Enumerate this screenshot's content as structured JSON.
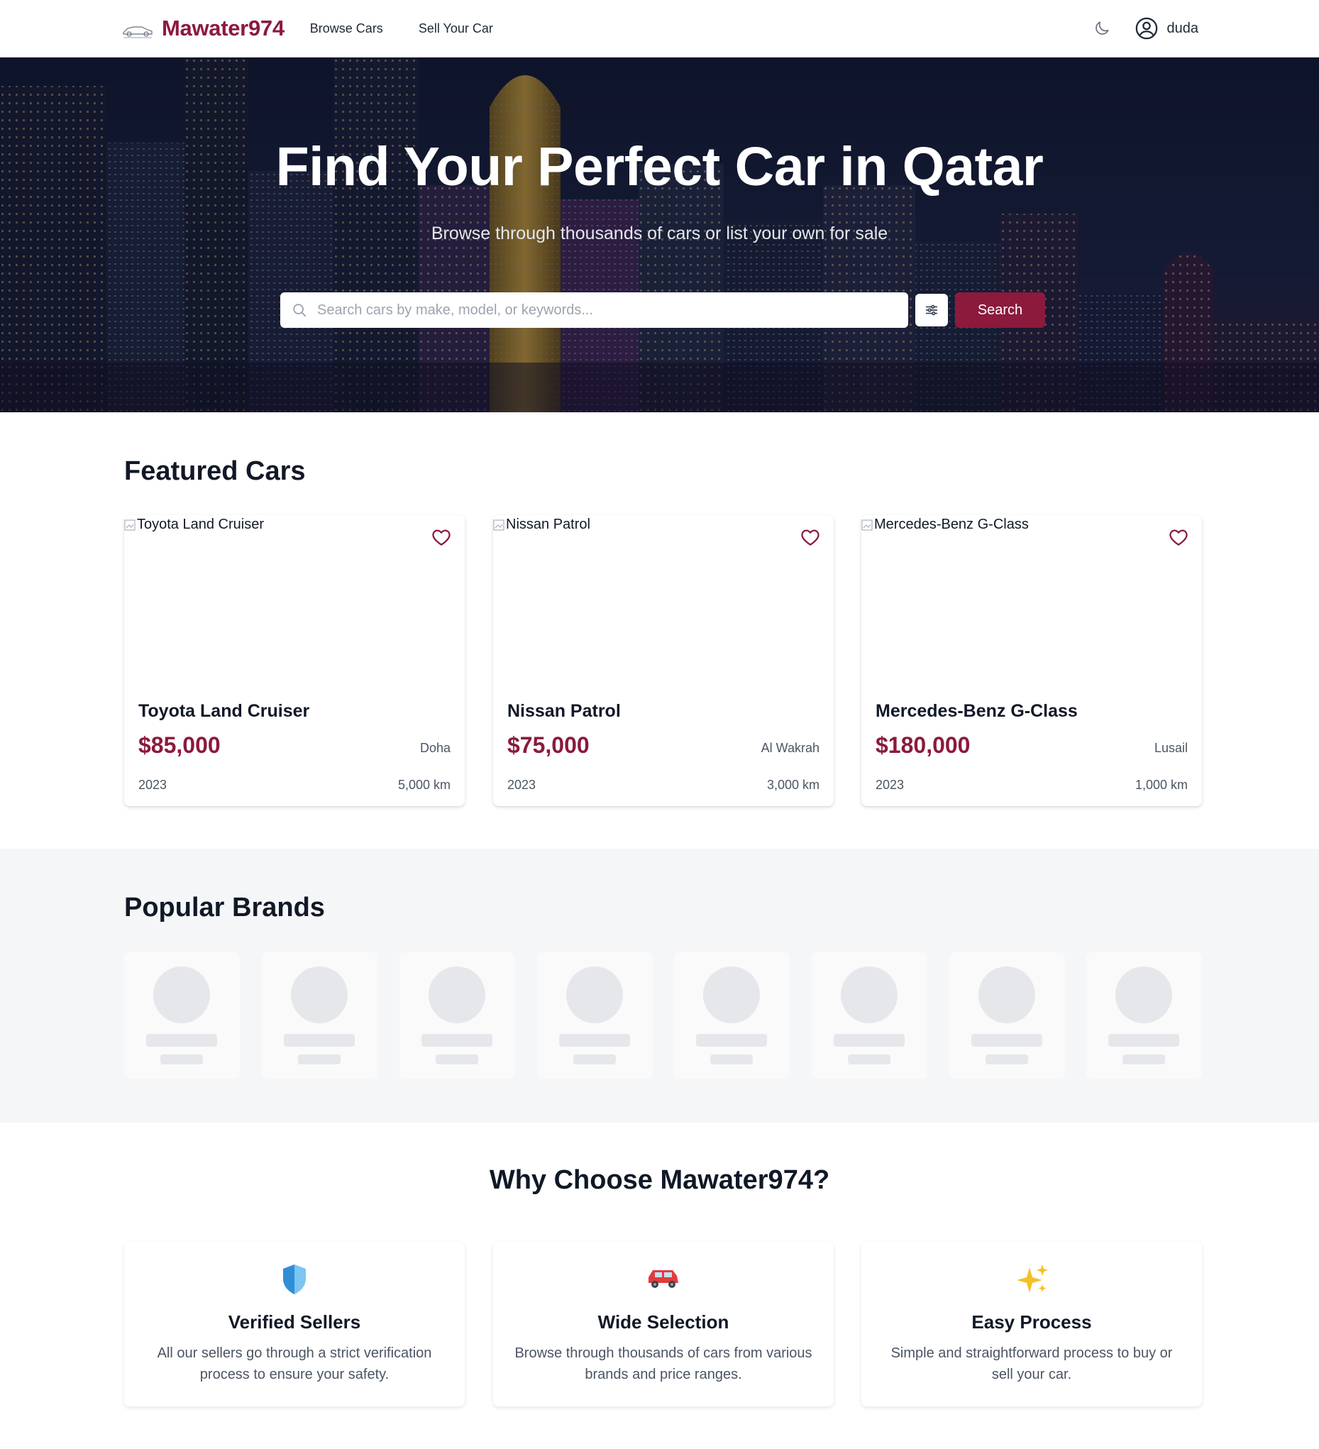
{
  "header": {
    "brand_name": "Mawater974",
    "nav": [
      {
        "label": "Browse Cars"
      },
      {
        "label": "Sell Your Car"
      }
    ],
    "user": {
      "name": "duda"
    },
    "icons": {
      "theme": "moon-icon",
      "user": "user-circle-icon"
    }
  },
  "hero": {
    "title": "Find Your Perfect Car in Qatar",
    "subtitle": "Browse through thousands of cars or list your own for sale",
    "search": {
      "placeholder": "Search cars by make, model, or keywords...",
      "value": "",
      "button_label": "Search"
    }
  },
  "featured": {
    "title": "Featured Cars",
    "cars": [
      {
        "image_alt": "Toyota Land Cruiser",
        "name": "Toyota Land Cruiser",
        "price": "$85,000",
        "location": "Doha",
        "year": "2023",
        "mileage": "5,000 km"
      },
      {
        "image_alt": "Nissan Patrol",
        "name": "Nissan Patrol",
        "price": "$75,000",
        "location": "Al Wakrah",
        "year": "2023",
        "mileage": "3,000 km"
      },
      {
        "image_alt": "Mercedes-Benz G-Class",
        "name": "Mercedes-Benz G-Class",
        "price": "$180,000",
        "location": "Lusail",
        "year": "2023",
        "mileage": "1,000 km"
      }
    ]
  },
  "brands": {
    "title": "Popular Brands",
    "loading_placeholders": 8
  },
  "why": {
    "title": "Why Choose Mawater974?",
    "features": [
      {
        "icon": "shield-icon",
        "title": "Verified Sellers",
        "description": "All our sellers go through a strict verification process to ensure your safety."
      },
      {
        "icon": "car-icon",
        "title": "Wide Selection",
        "description": "Browse through thousands of cars from various brands and price ranges."
      },
      {
        "icon": "sparkles-icon",
        "title": "Easy Process",
        "description": "Simple and straightforward process to buy or sell your car."
      }
    ]
  },
  "colors": {
    "brand": "#8b1a3d",
    "text": "#111827",
    "muted": "#4b5563",
    "skeleton": "#e5e7eb",
    "section_bg": "#f5f6f8"
  }
}
